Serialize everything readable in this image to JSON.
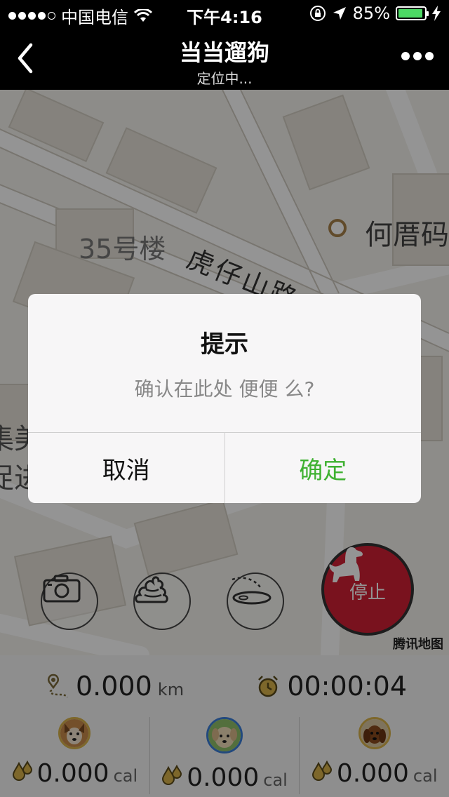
{
  "status_bar": {
    "carrier": "中国电信",
    "time": "下午4:16",
    "battery": "85%",
    "battery_level": 0.85
  },
  "nav": {
    "title": "当当遛狗",
    "subtitle": "定位中..."
  },
  "map": {
    "building_label": "35号楼",
    "road_label": "虎仔山路",
    "poi_label": "何厝码",
    "side_label_1": "集美",
    "side_label_2": "促进",
    "credit": "腾讯地图"
  },
  "actions": {
    "stop_label": "停止"
  },
  "stats": {
    "distance_value": "0.000",
    "distance_unit": "km",
    "duration": "00:00:04",
    "dogs": [
      {
        "calories": "0.000",
        "unit": "cal",
        "selected": false
      },
      {
        "calories": "0.000",
        "unit": "cal",
        "selected": true
      },
      {
        "calories": "0.000",
        "unit": "cal",
        "selected": false
      }
    ]
  },
  "dialog": {
    "title": "提示",
    "message": "确认在此处 便便 么?",
    "cancel_label": "取消",
    "confirm_label": "确定"
  },
  "colors": {
    "confirm": "#3fb131",
    "stop_button": "#d12034",
    "battery": "#4cd964",
    "selected_avatar_ring": "#3b7ed8"
  }
}
